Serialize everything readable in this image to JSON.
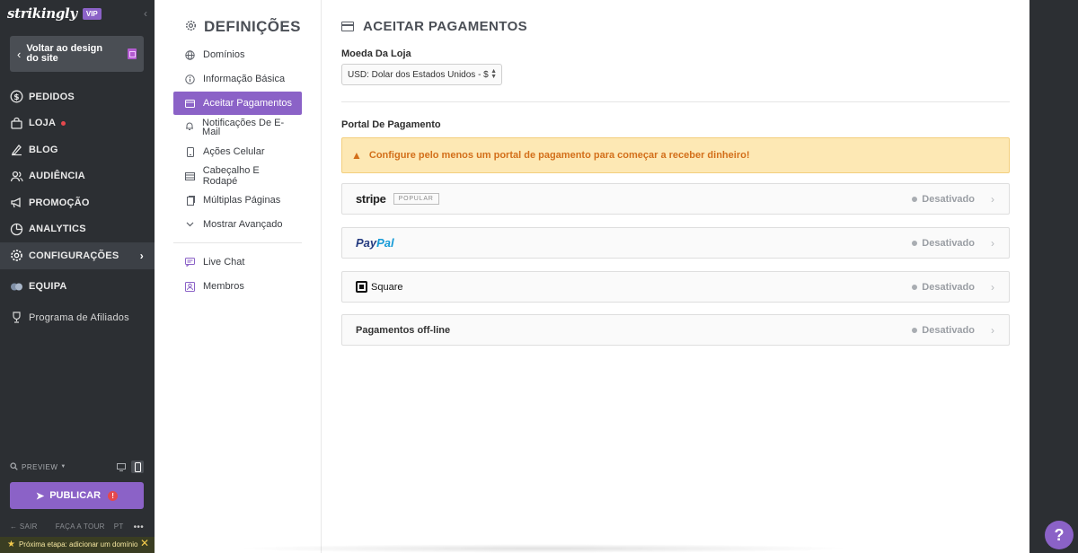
{
  "sidebar": {
    "logo": "strikingly",
    "vip_badge": "VIP",
    "back_button": "Voltar ao design do site",
    "nav": [
      {
        "label": "PEDIDOS",
        "icon": "dollar-circle-icon"
      },
      {
        "label": "LOJA",
        "icon": "store-icon",
        "dot": true
      },
      {
        "label": "BLOG",
        "icon": "pen-icon"
      },
      {
        "label": "AUDIÊNCIA",
        "icon": "people-icon"
      },
      {
        "label": "PROMOÇÃO",
        "icon": "megaphone-icon"
      },
      {
        "label": "ANALYTICS",
        "icon": "chart-icon"
      },
      {
        "label": "CONFIGURAÇÕES",
        "icon": "gear-icon",
        "active": true
      },
      {
        "label": "EQUIPA",
        "icon": "team-icon"
      },
      {
        "label": "Programa de Afiliados",
        "icon": "trophy-icon"
      }
    ],
    "preview_label": "PREVIEW",
    "publish_label": "PUBLICAR",
    "footer": {
      "exit": "SAIR",
      "tour": "FAÇA A TOUR",
      "lang": "PT",
      "more": "•••"
    },
    "next_step": "Próxima etapa: adicionar um domínio"
  },
  "settings": {
    "title": "DEFINIÇÕES",
    "items": [
      {
        "label": "Domínios",
        "icon": "globe-icon"
      },
      {
        "label": "Informação Básica",
        "icon": "info-icon"
      },
      {
        "label": "Aceitar Pagamentos",
        "icon": "card-icon",
        "active": true
      },
      {
        "label": "Notificações De E-Mail",
        "icon": "bell-icon"
      },
      {
        "label": "Ações Celular",
        "icon": "mobile-icon"
      },
      {
        "label": "Cabeçalho E Rodapé",
        "icon": "layout-icon"
      },
      {
        "label": "Múltiplas Páginas",
        "icon": "pages-icon"
      },
      {
        "label": "Mostrar Avançado",
        "icon": "chevron-down-icon"
      }
    ],
    "apps": [
      {
        "label": "Live Chat",
        "icon": "chat-icon"
      },
      {
        "label": "Membros",
        "icon": "member-icon"
      }
    ]
  },
  "main": {
    "title": "ACEITAR PAGAMENTOS",
    "currency_label": "Moeda Da Loja",
    "currency_value": "USD: Dolar dos Estados Unidos - $",
    "portal_label": "Portal De Pagamento",
    "alert": "Configure pelo menos um portal de pagamento para começar a receber dinheiro!",
    "gateways": [
      {
        "name": "stripe",
        "badge": "POPULAR",
        "status": "Desativado"
      },
      {
        "name": "PayPal",
        "status": "Desativado"
      },
      {
        "name": "Square",
        "status": "Desativado"
      },
      {
        "name": "Pagamentos off-line",
        "status": "Desativado"
      }
    ]
  },
  "help_label": "?"
}
